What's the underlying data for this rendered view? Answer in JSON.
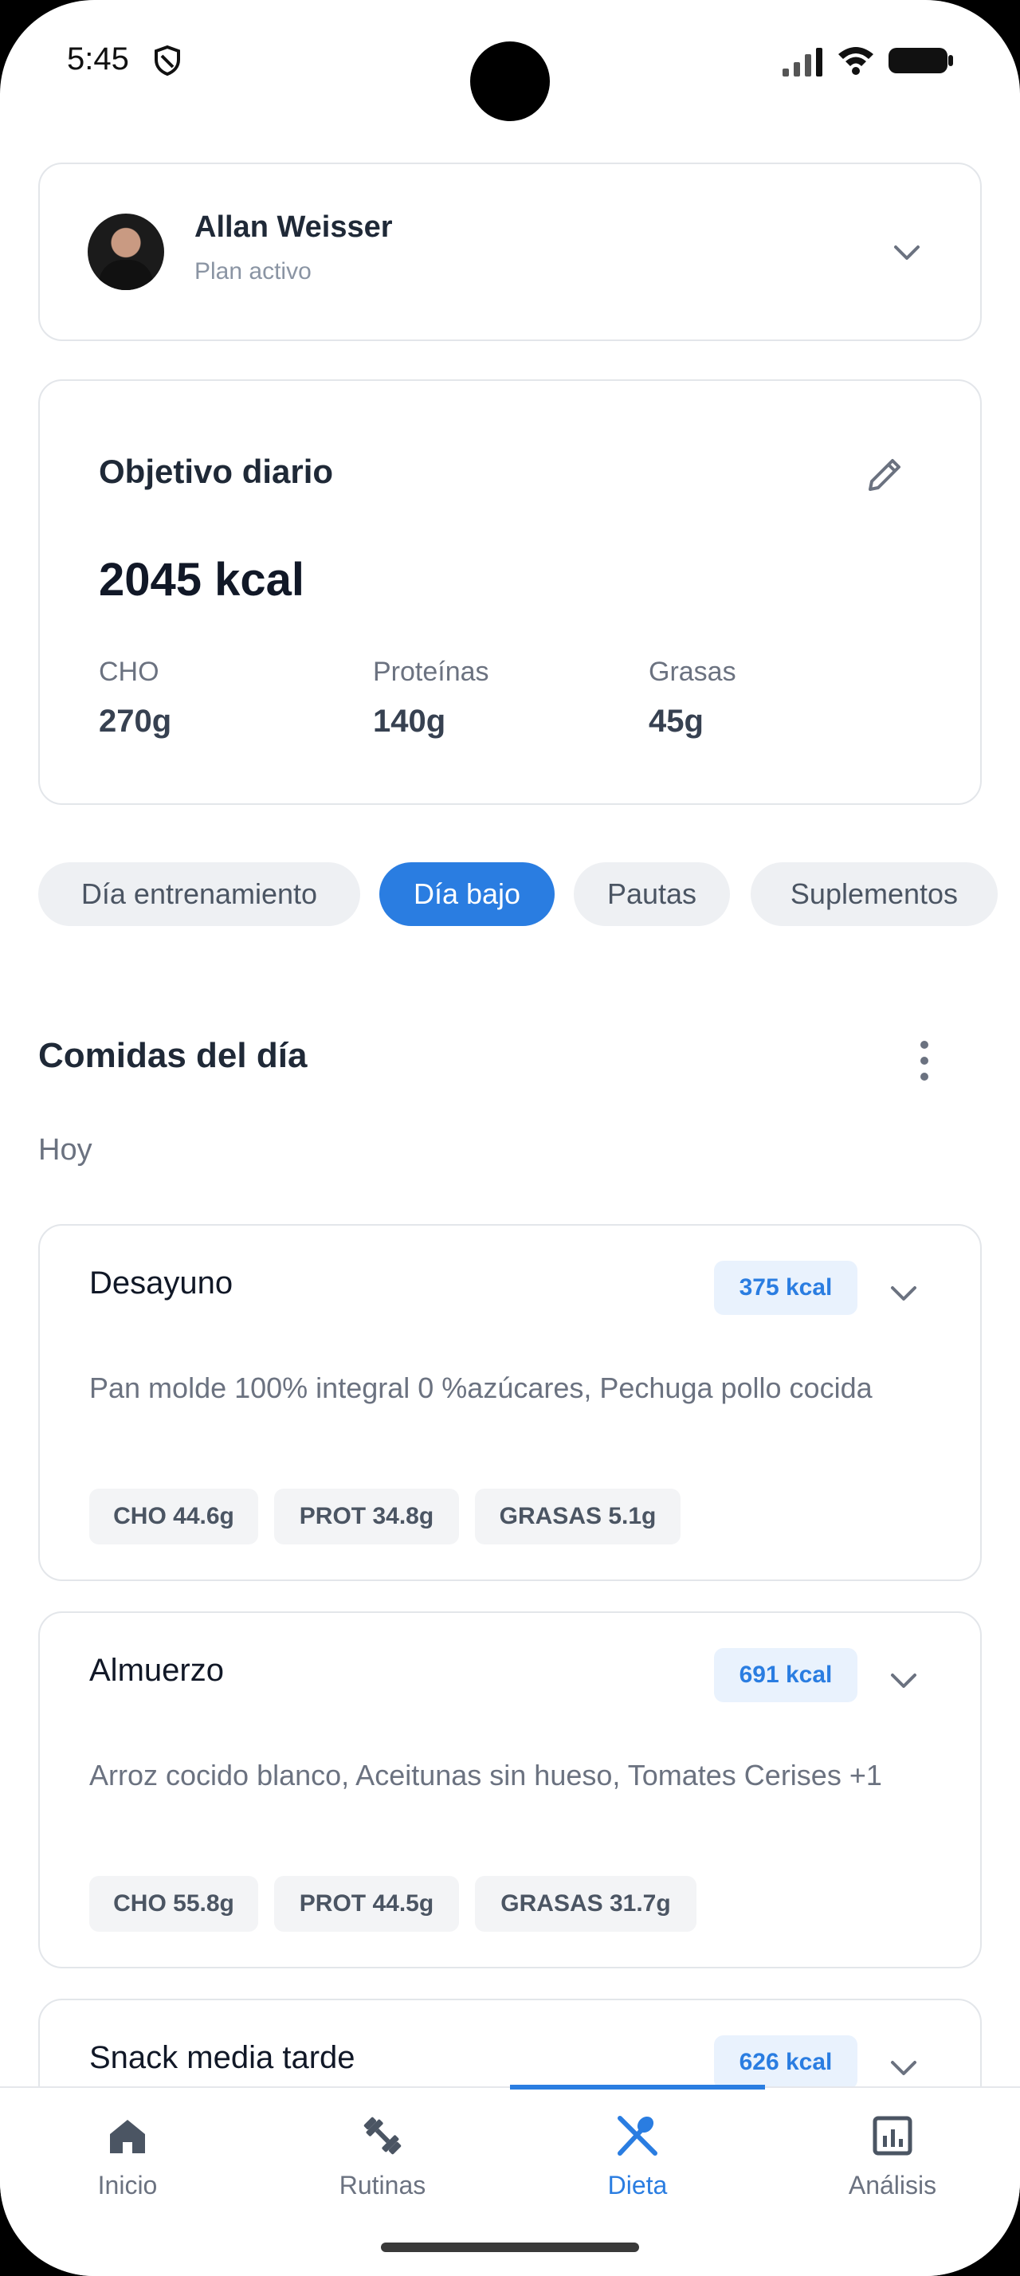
{
  "status_bar": {
    "time": "5:45"
  },
  "profile": {
    "name": "Allan Weisser",
    "subtitle": "Plan activo"
  },
  "goal": {
    "title": "Objetivo diario",
    "kcal": "2045 kcal",
    "macros": [
      {
        "label": "CHO",
        "value": "270g"
      },
      {
        "label": "Proteínas",
        "value": "140g"
      },
      {
        "label": "Grasas",
        "value": "45g"
      }
    ]
  },
  "tabs": [
    {
      "label": "Día entrenamiento",
      "active": false
    },
    {
      "label": "Día bajo",
      "active": true
    },
    {
      "label": "Pautas",
      "active": false
    },
    {
      "label": "Suplementos",
      "active": false
    }
  ],
  "meals_section": {
    "title": "Comidas del día",
    "day": "Hoy"
  },
  "meals": [
    {
      "name": "Desayuno",
      "kcal": "375 kcal",
      "description": "Pan molde 100% integral 0 %azúcares, Pechuga pollo cocida",
      "chips": [
        "CHO 44.6g",
        "PROT 34.8g",
        "GRASAS 5.1g"
      ]
    },
    {
      "name": "Almuerzo",
      "kcal": "691 kcal",
      "description": "Arroz cocido blanco, Aceitunas sin hueso, Tomates Cerises +1",
      "chips": [
        "CHO 55.8g",
        "PROT 44.5g",
        "GRASAS 31.7g"
      ]
    },
    {
      "name": "Snack media tarde",
      "kcal": "626 kcal"
    }
  ],
  "bottom_nav": [
    {
      "label": "Inicio",
      "icon": "home-icon",
      "active": false
    },
    {
      "label": "Rutinas",
      "icon": "dumbbell-icon",
      "active": false
    },
    {
      "label": "Dieta",
      "icon": "utensils-icon",
      "active": true
    },
    {
      "label": "Análisis",
      "icon": "chart-icon",
      "active": false
    }
  ],
  "colors": {
    "accent": "#2a7de1",
    "text": "#1f2937",
    "muted": "#6b7280"
  }
}
